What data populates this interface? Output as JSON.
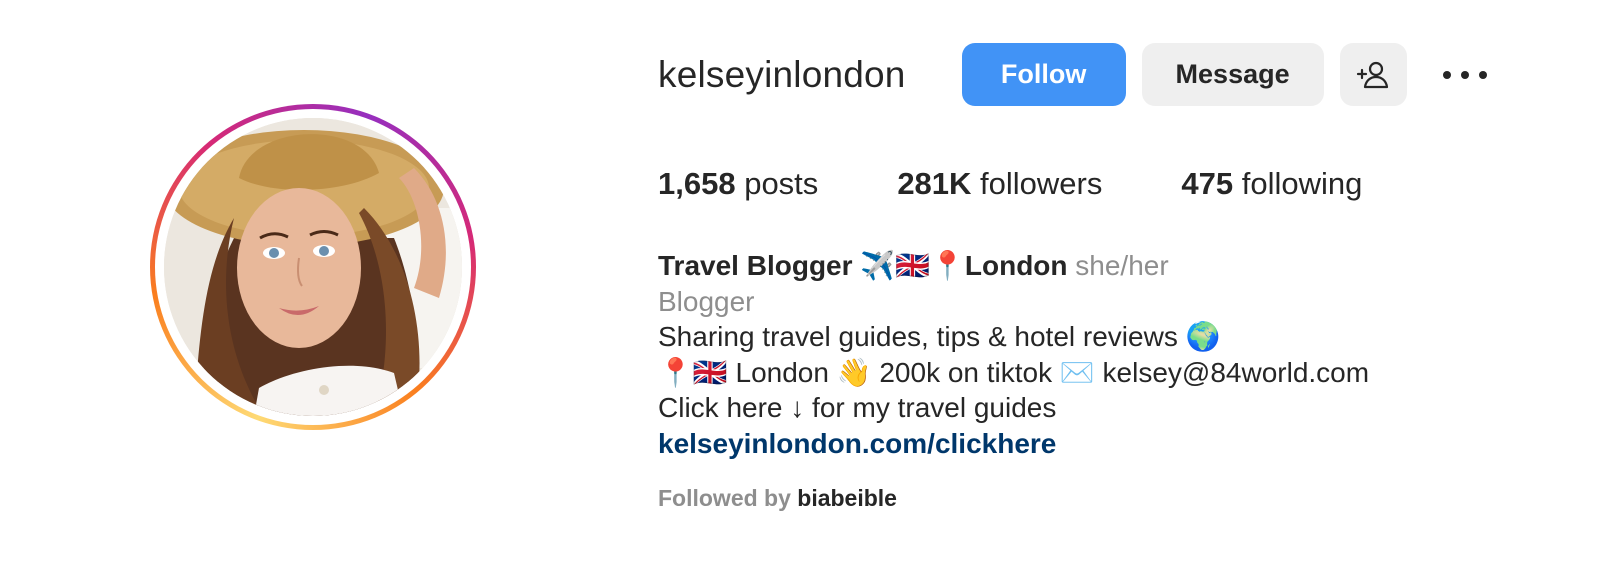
{
  "profile": {
    "username": "kelseyinlondon",
    "avatar_alt": "profile-photo"
  },
  "actions": {
    "follow_label": "Follow",
    "message_label": "Message",
    "suggest_icon": "person-add-icon",
    "more_icon": "more-horizontal-icon"
  },
  "stats": {
    "posts_count": "1,658",
    "posts_label": "posts",
    "followers_count": "281K",
    "followers_label": "followers",
    "following_count": "475",
    "following_label": "following"
  },
  "bio": {
    "name": "Travel Blogger ✈️🇬🇧📍London",
    "pronouns": "she/her",
    "category": "Blogger",
    "line1": "Sharing travel guides, tips & hotel reviews 🌍",
    "line2": "📍🇬🇧 London 👋 200k on tiktok ✉️ kelsey@84world.com",
    "line3": "Click here ↓ for my travel guides",
    "link": "kelseyinlondon.com/clickhere"
  },
  "followed_by": {
    "prefix": "Followed by",
    "user": "biabeible"
  },
  "colors": {
    "follow_button": "#4193f6",
    "secondary_button": "#efefef",
    "link": "#00376b",
    "muted_text": "#8e8e8e",
    "primary_text": "#262626"
  }
}
